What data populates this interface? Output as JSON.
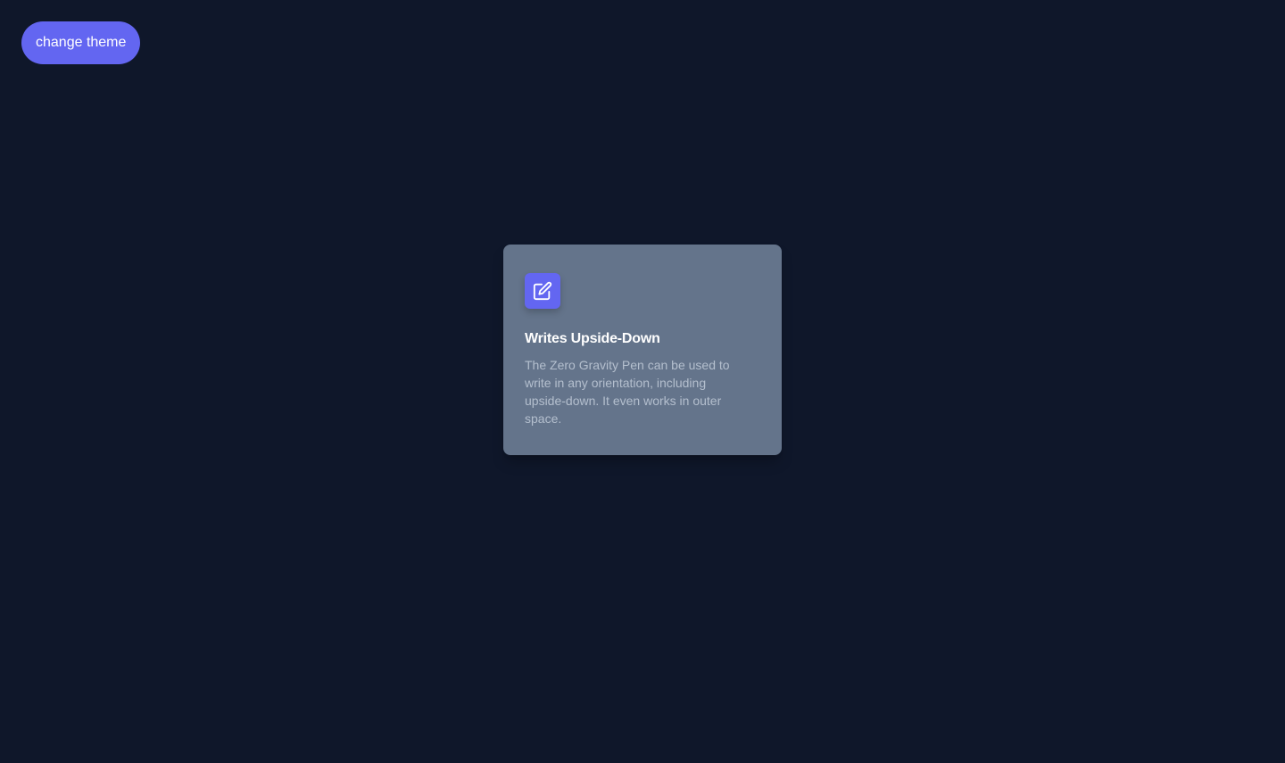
{
  "toolbar": {
    "theme_button_label": "change theme"
  },
  "feature_card": {
    "icon": "pencil-square-icon",
    "title": "Writes Upside-Down",
    "description": "The Zero Gravity Pen can be used to write in any orientation, including upside-down. It even works in outer space."
  },
  "colors": {
    "background": "#0f172a",
    "accent": "#6366f1",
    "card": "#64748b",
    "text_primary": "#ffffff",
    "text_secondary": "#b4bfce"
  }
}
